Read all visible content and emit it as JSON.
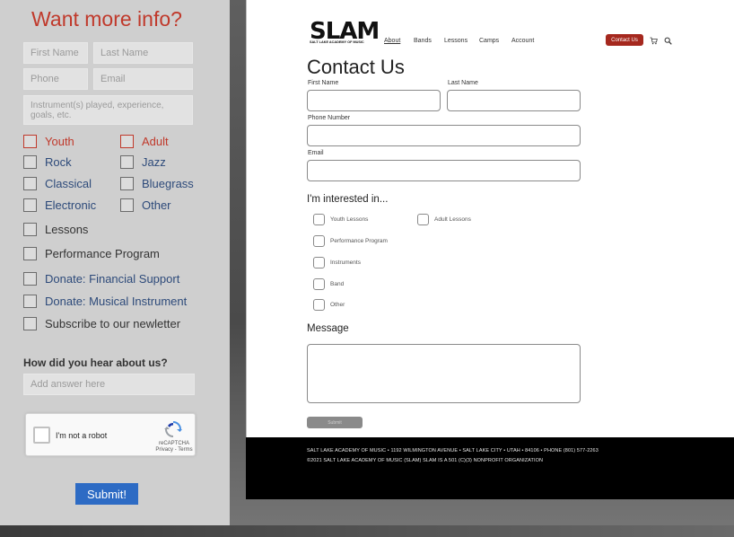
{
  "left_panel": {
    "title": "Want more info?",
    "first_name_placeholder": "First Name",
    "last_name_placeholder": "Last Name",
    "phone_placeholder": "Phone",
    "email_placeholder": "Email",
    "details_placeholder": "Instrument(s) played, experience, goals, etc.",
    "options": {
      "youth": "Youth",
      "adult": "Adult",
      "rock": "Rock",
      "jazz": "Jazz",
      "classical": "Classical",
      "bluegrass": "Bluegrass",
      "electronic": "Electronic",
      "other": "Other",
      "lessons": "Lessons",
      "performance": "Performance Program",
      "donate_financial": "Donate: Financial Support",
      "donate_instrument": "Donate: Musical Instrument",
      "subscribe": "Subscribe to our newletter"
    },
    "how_heading": "How did you hear about us?",
    "how_placeholder": "Add answer here",
    "recaptcha": {
      "label": "I'm not a robot",
      "brand": "reCAPTCHA",
      "links": "Privacy - Terms"
    },
    "submit": "Submit!"
  },
  "site": {
    "logo": "SLAM",
    "logo_sub": "SALT LAKE ACADEMY OF MUSIC",
    "nav": [
      "About",
      "Bands",
      "Lessons",
      "Camps",
      "Account"
    ],
    "contact_button": "Contact Us",
    "page_title": "Contact Us",
    "labels": {
      "first_name": "First Name",
      "last_name": "Last Name",
      "phone": "Phone Number",
      "email": "Email"
    },
    "interested_heading": "I'm interested in...",
    "interests": {
      "youth_lessons": "Youth Lessons",
      "adult_lessons": "Adult Lessons",
      "performance": "Performance Program",
      "instruments": "Instruments",
      "band": "Band",
      "other": "Other"
    },
    "message_heading": "Message",
    "submit": "Submit",
    "footer_line1": "SALT LAKE ACADEMY OF MUSIC • 1192 WILMINGTON AVENUE • SALT LAKE CITY • UTAH • 84106 • PHONE (801) 577-2263",
    "footer_line2": "©2021 SALT LAKE ACADEMY OF MUSIC (SLAM) SLAM IS A 501 (C)(3) NONPROFIT ORGANIZATION"
  },
  "colors": {
    "accent_red": "#c0392b",
    "navy": "#2d4a7a",
    "submit_blue": "#2d6bc4",
    "contact_red": "#a5281e"
  }
}
